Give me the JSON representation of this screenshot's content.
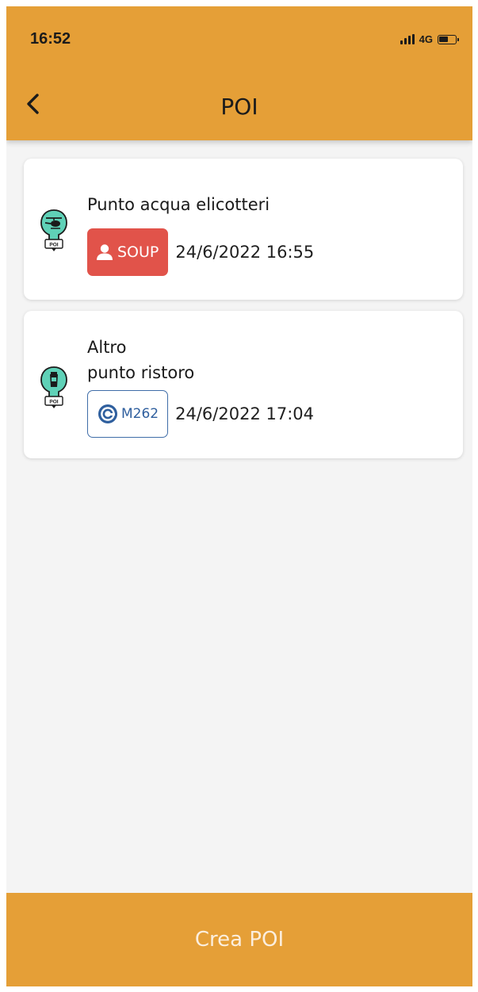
{
  "status_bar": {
    "time": "16:52",
    "network": "4G",
    "icons": [
      "signal-icon",
      "battery-icon"
    ]
  },
  "header": {
    "title": "POI",
    "back_icon": "chevron-left-icon"
  },
  "poi_list": [
    {
      "icon": "helicopter-water-poi-icon",
      "name": "Punto acqua elicotteri",
      "chip_type": "user",
      "chip_icon": "person-icon",
      "chip_label": "SOUP",
      "date": "24/6/2022 16:55"
    },
    {
      "icon": "refreshment-poi-icon",
      "name_line1": "Altro",
      "name_line2": "punto ristoro",
      "chip_type": "device",
      "chip_icon": "radio-target-icon",
      "chip_label": "M262",
      "date": "24/6/2022 17:04"
    }
  ],
  "footer": {
    "create_label": "Crea POI"
  },
  "colors": {
    "accent": "#e59f37",
    "user_chip": "#e1534a",
    "device_chip": "#3f6da8",
    "poi_icon": "#5fd1b7"
  }
}
